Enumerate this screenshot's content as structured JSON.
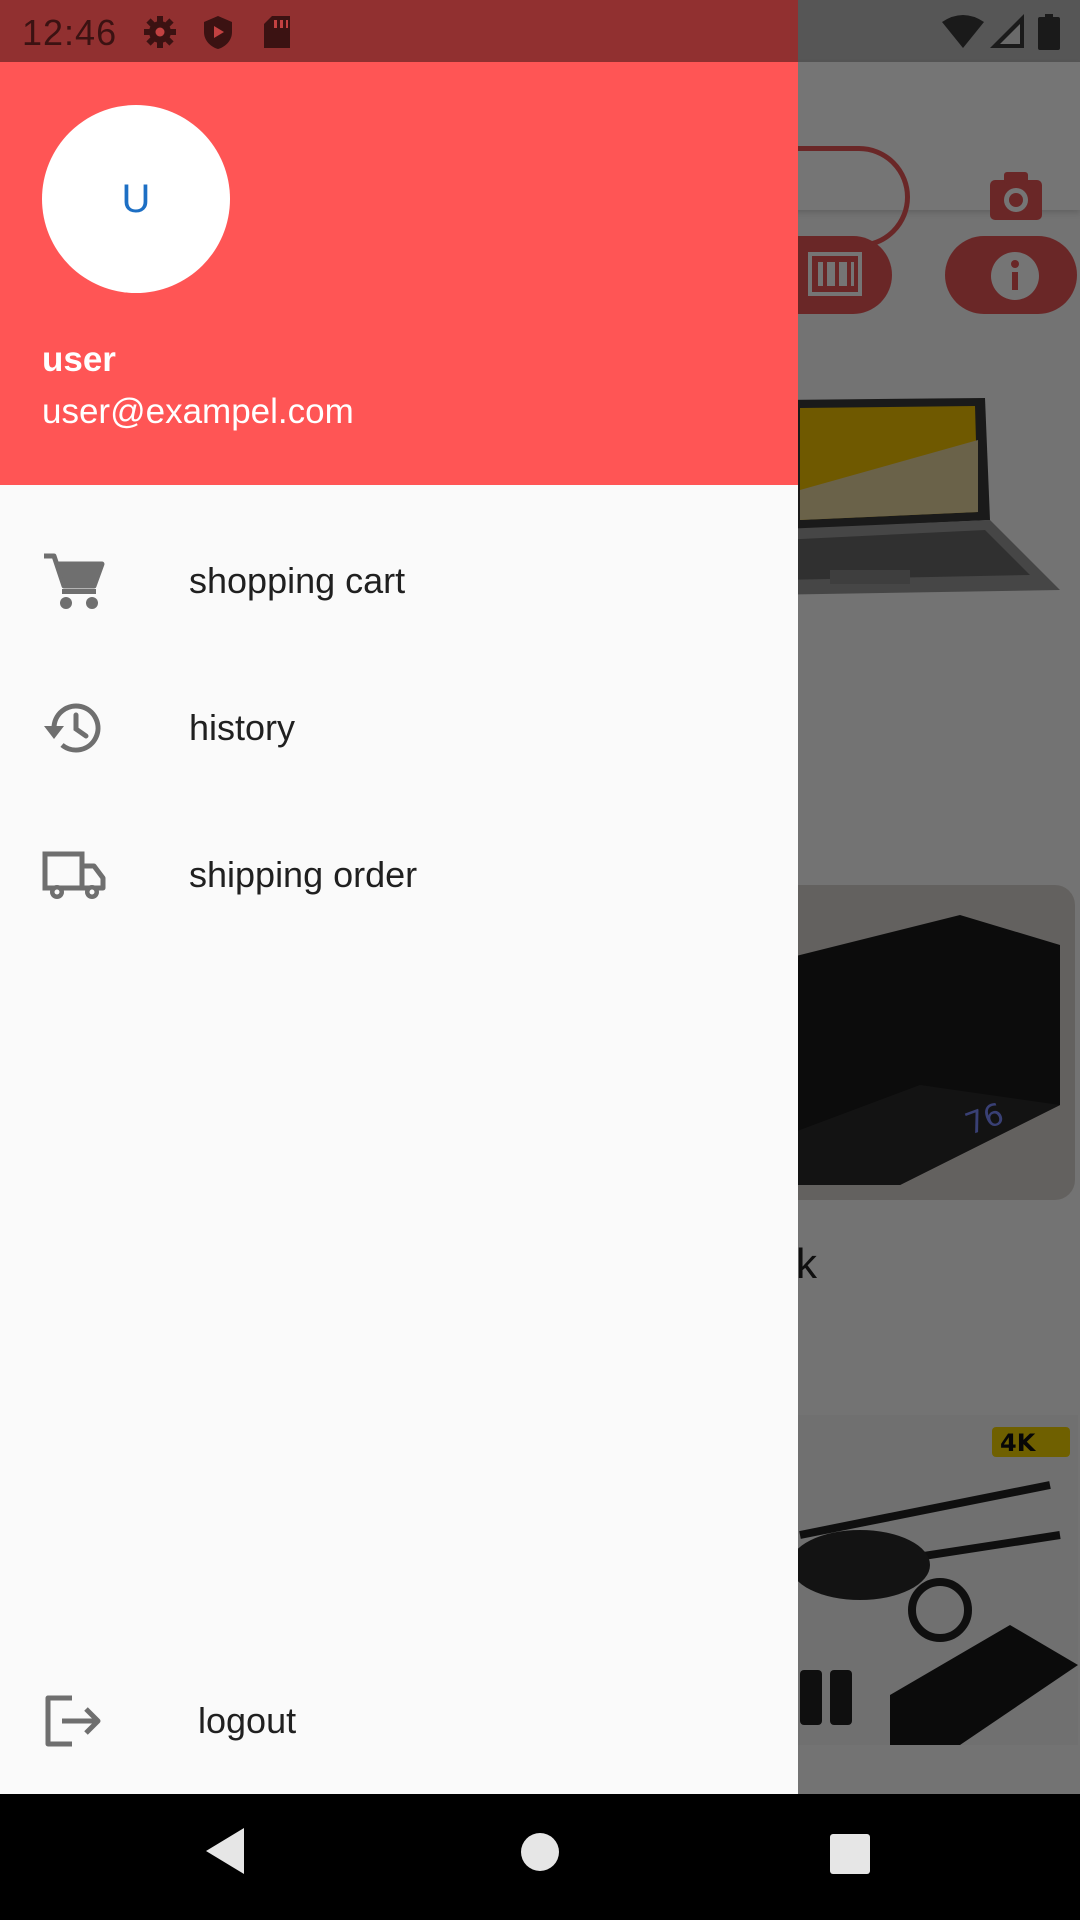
{
  "status_bar": {
    "time": "12:46",
    "icons": [
      "gear-icon",
      "shield-icon",
      "sd-card-icon",
      "wifi-icon",
      "signal-icon",
      "battery-icon"
    ]
  },
  "background_app": {
    "partial_text": "k",
    "accent_color": "#e85555"
  },
  "drawer": {
    "header_color": "#ff5555",
    "avatar_initial": "U",
    "user_name": "user",
    "user_email": "user@exampel.com",
    "menu": [
      {
        "label": "shopping cart",
        "icon": "cart-icon"
      },
      {
        "label": "history",
        "icon": "history-icon"
      },
      {
        "label": "shipping order",
        "icon": "truck-icon"
      }
    ],
    "logout": {
      "label": "logout",
      "icon": "logout-icon"
    }
  },
  "nav_bar": {
    "buttons": [
      "back-icon",
      "home-icon",
      "recents-icon"
    ]
  }
}
